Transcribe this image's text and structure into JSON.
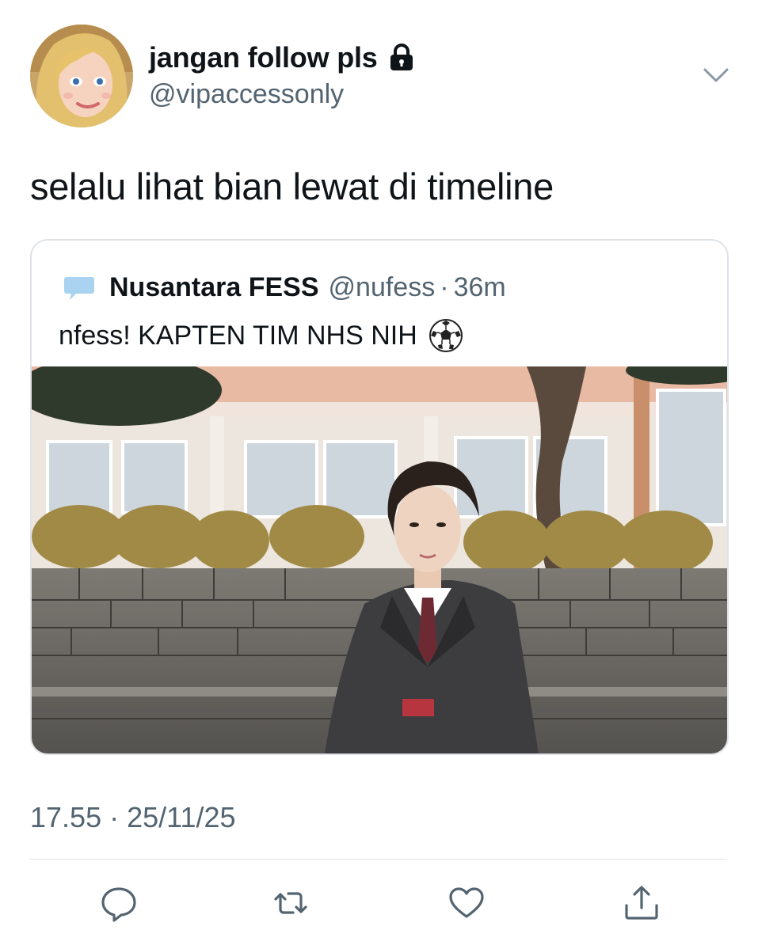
{
  "tweet": {
    "author": {
      "display_name": "jangan follow pls",
      "handle": "@vipaccessonly",
      "avatar_icon": "avatar-blonde-doll",
      "protected_icon": "lock-icon"
    },
    "text": "selalu lihat bian lewat di timeline",
    "timestamp": "17.55 · 25/11/25"
  },
  "quote": {
    "display_name": "Nusantara FESS",
    "handle": "@nufess",
    "separator": "·",
    "time": "36m",
    "text": "nfess! KAPTEN TIM NHS NIH",
    "emoji_icon": "soccer-ball-icon",
    "media_icon": "photo-student-in-blazer",
    "avatar_badge": "NUSANTARA FESS"
  },
  "actions": {
    "reply_icon": "reply-icon",
    "retweet_icon": "retweet-icon",
    "like_icon": "heart-icon",
    "share_icon": "share-icon"
  },
  "colors": {
    "text_primary": "#0f1419",
    "text_secondary": "#536471",
    "border": "#dfe3e7",
    "icon": "#536471"
  }
}
